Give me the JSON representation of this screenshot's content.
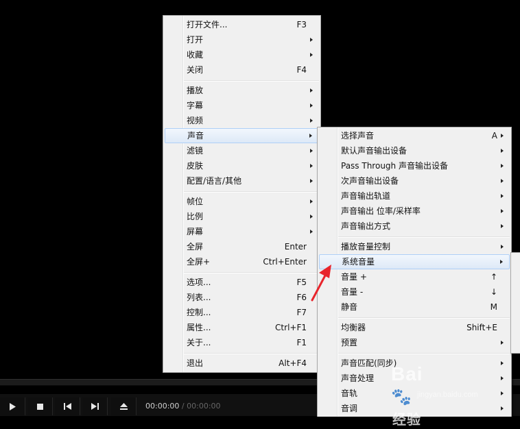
{
  "main_menu": {
    "items": [
      {
        "label": "打开文件...",
        "shortcut": "F3"
      },
      {
        "label": "打开",
        "shortcut": ""
      },
      {
        "label": "收藏",
        "shortcut": ""
      },
      {
        "label": "关闭",
        "shortcut": "F4"
      },
      {
        "label": "播放",
        "shortcut": ""
      },
      {
        "label": "字幕",
        "shortcut": ""
      },
      {
        "label": "视频",
        "shortcut": ""
      },
      {
        "label": "声音",
        "shortcut": ""
      },
      {
        "label": "滤镜",
        "shortcut": ""
      },
      {
        "label": "皮肤",
        "shortcut": ""
      },
      {
        "label": "配置/语言/其他",
        "shortcut": ""
      },
      {
        "label": "帧位",
        "shortcut": ""
      },
      {
        "label": "比例",
        "shortcut": ""
      },
      {
        "label": "屏幕",
        "shortcut": ""
      },
      {
        "label": "全屏",
        "shortcut": "Enter"
      },
      {
        "label": "全屏+",
        "shortcut": "Ctrl+Enter"
      },
      {
        "label": "选项...",
        "shortcut": "F5"
      },
      {
        "label": "列表...",
        "shortcut": "F6"
      },
      {
        "label": "控制...",
        "shortcut": "F7"
      },
      {
        "label": "属性...",
        "shortcut": "Ctrl+F1"
      },
      {
        "label": "关于...",
        "shortcut": "F1"
      },
      {
        "label": "退出",
        "shortcut": "Alt+F4"
      }
    ]
  },
  "sound_menu": {
    "items": [
      {
        "label": "选择声音",
        "shortcut": "A"
      },
      {
        "label": "默认声音输出设备",
        "shortcut": ""
      },
      {
        "label": "Pass Through 声音输出设备",
        "shortcut": ""
      },
      {
        "label": "次声音输出设备",
        "shortcut": ""
      },
      {
        "label": "声音输出轨道",
        "shortcut": ""
      },
      {
        "label": "声音输出 位率/采样率",
        "shortcut": ""
      },
      {
        "label": "声音输出方式",
        "shortcut": ""
      },
      {
        "label": "播放音量控制",
        "shortcut": ""
      },
      {
        "label": "系统音量",
        "shortcut": ""
      },
      {
        "label": "音量 +",
        "shortcut": "↑"
      },
      {
        "label": "音量 -",
        "shortcut": "↓"
      },
      {
        "label": "静音",
        "shortcut": "M"
      },
      {
        "label": "均衡器",
        "shortcut": "Shift+E"
      },
      {
        "label": "预置",
        "shortcut": ""
      },
      {
        "label": "声音匹配(同步)",
        "shortcut": ""
      },
      {
        "label": "声音处理",
        "shortcut": ""
      },
      {
        "label": "音轨",
        "shortcut": ""
      },
      {
        "label": "音调",
        "shortcut": ""
      }
    ]
  },
  "player": {
    "current_time": "00:00:00",
    "separator": "/",
    "total_time": "00:00:00"
  },
  "watermark": {
    "text": "Bai",
    "text2": "经验",
    "sub": "jingyan.baidu.com"
  },
  "colors": {
    "menu_bg": "#f0f0f0",
    "highlight": "#dde9f7",
    "annotation_arrow": "#e8252c"
  }
}
